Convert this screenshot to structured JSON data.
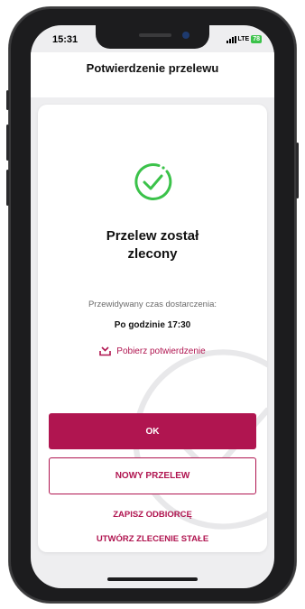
{
  "status_bar": {
    "time": "15:31",
    "network": "LTE",
    "battery": "78"
  },
  "header": {
    "title": "Potwierdzenie przelewu"
  },
  "confirmation": {
    "title_line1": "Przelew został",
    "title_line2": "zlecony",
    "delivery_label": "Przewidywany czas dostarczenia:",
    "delivery_value": "Po godzinie 17:30",
    "download_label": "Pobierz potwierdzenie"
  },
  "actions": {
    "ok_label": "OK",
    "new_transfer_label": "NOWY PRZELEW",
    "save_recipient_label": "ZAPISZ ODBIORCĘ",
    "standing_order_label": "UTWÓRZ ZLECENIE STAŁE"
  },
  "icons": {
    "success": "check-circle-icon",
    "download": "download-tray-icon",
    "signal": "signal-icon",
    "battery": "battery-icon"
  },
  "colors": {
    "accent": "#b01550",
    "success": "#3bc24a",
    "background": "#eeeef0"
  }
}
